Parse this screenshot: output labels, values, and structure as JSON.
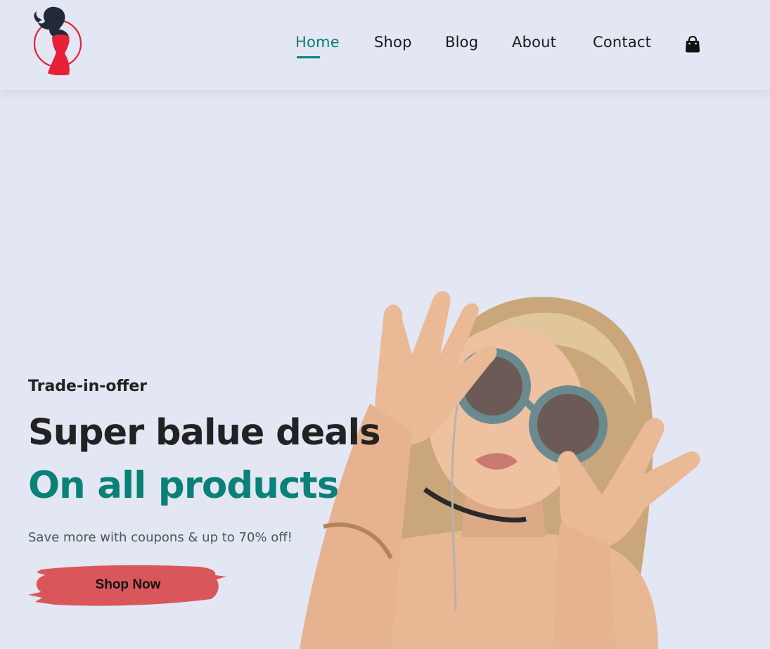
{
  "header": {
    "logo": {
      "icon": "woman-in-red-dress-logo",
      "brand_color": "#e8213a"
    },
    "nav": [
      {
        "label": "Home",
        "active": true
      },
      {
        "label": "Shop",
        "active": false
      },
      {
        "label": "Blog",
        "active": false
      },
      {
        "label": "About",
        "active": false
      },
      {
        "label": "Contact",
        "active": false
      }
    ],
    "cart_icon": "shopping-bag-icon"
  },
  "hero": {
    "eyebrow": "Trade-in-offer",
    "headline": "Super balue deals",
    "headline_accent": "On all products",
    "subtext": "Save more with coupons & up to 70% off!",
    "cta_label": "Shop Now",
    "image": "woman-with-round-sunglasses",
    "colors": {
      "accent": "#088178",
      "cta_bg": "#d9575a",
      "background": "#e3e6f3"
    }
  }
}
